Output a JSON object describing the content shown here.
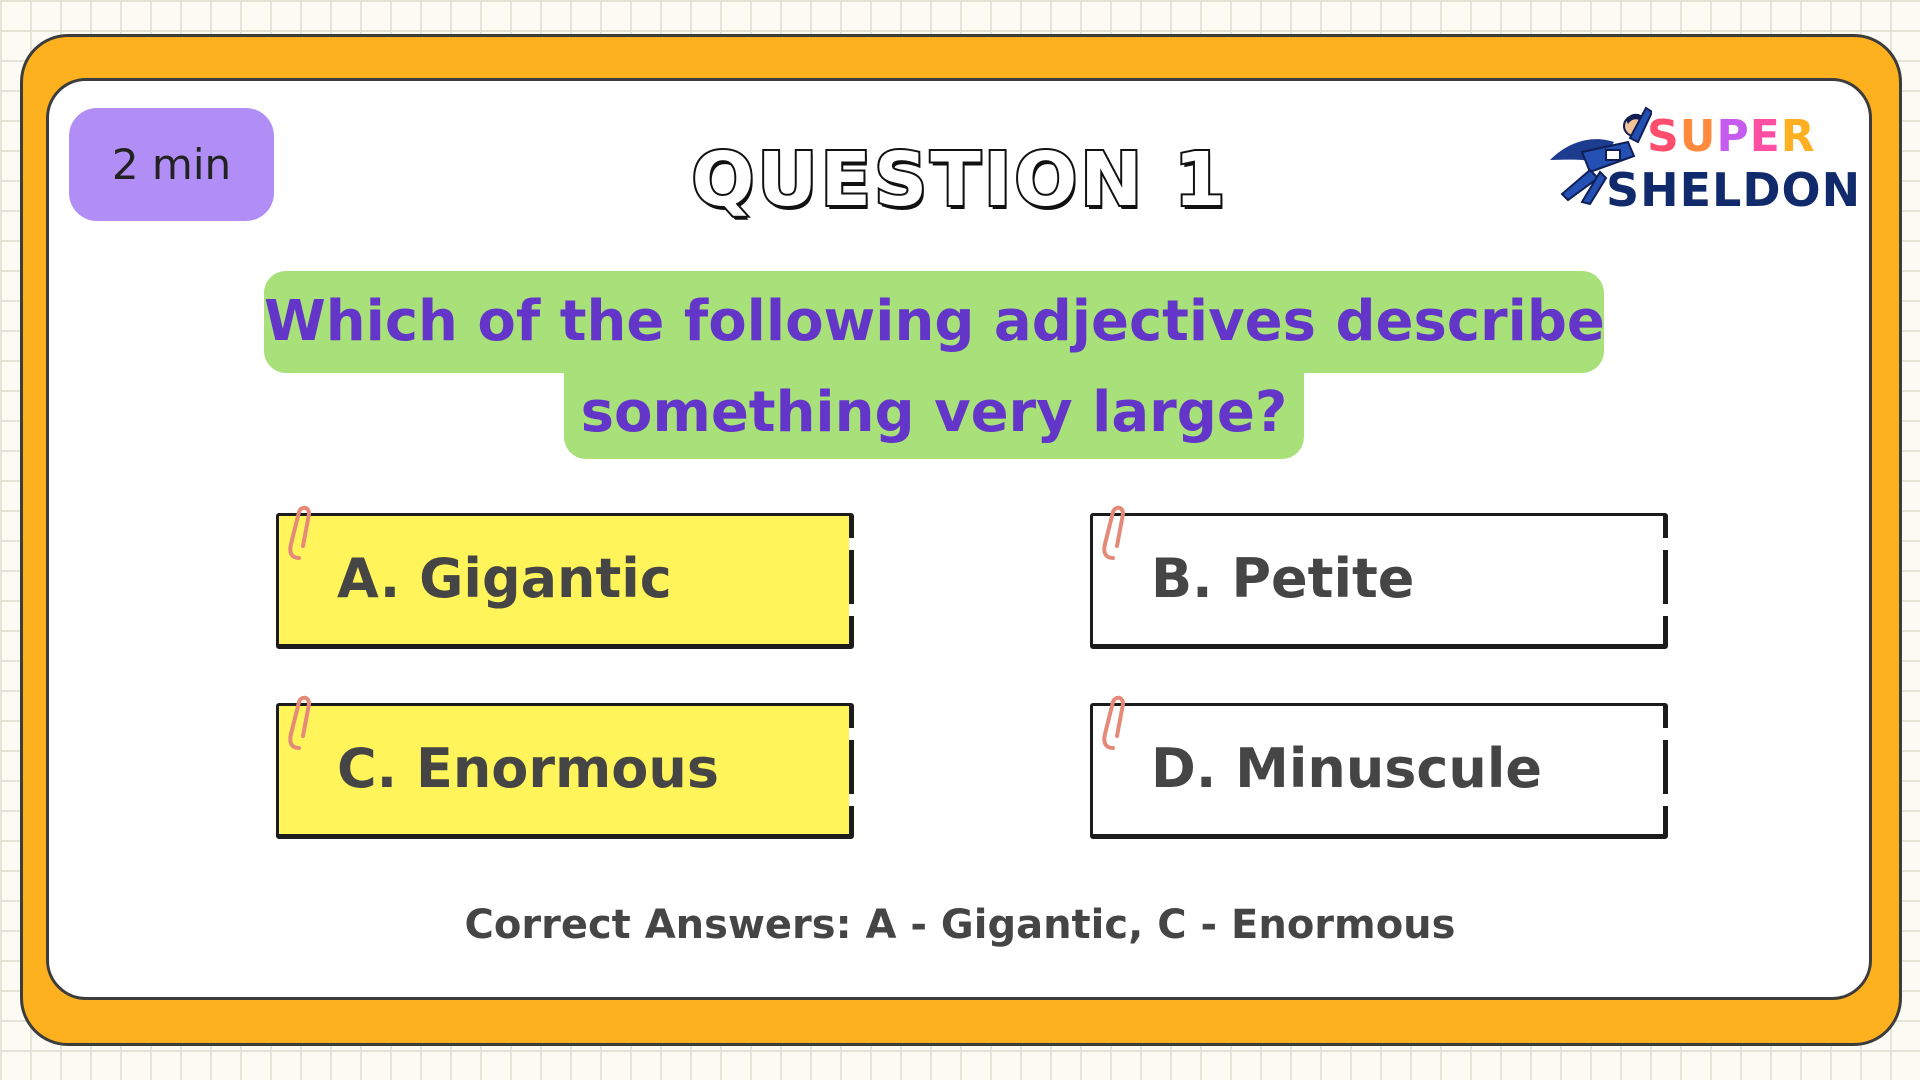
{
  "timer": {
    "label": "2 min"
  },
  "heading": {
    "title": "QUESTION 1"
  },
  "logo": {
    "word1": "SUPER",
    "word2": "SHELDON",
    "word1_colors": [
      "#ff4d6d",
      "#ff8a3d",
      "#c65bf0",
      "#ff4fa3",
      "#ffb020"
    ]
  },
  "question": {
    "line1": "Which of the following adjectives describe",
    "line2": "something very large?"
  },
  "options": [
    {
      "label": "A. Gigantic",
      "highlighted": true
    },
    {
      "label": "B. Petite",
      "highlighted": false
    },
    {
      "label": "C. Enormous",
      "highlighted": true
    },
    {
      "label": "D. Minuscule",
      "highlighted": false
    }
  ],
  "answers": {
    "text": "Correct Answers: A - Gigantic, C - Enormous"
  },
  "colors": {
    "frame": "#feb11e",
    "timer_bg": "#b18ef5",
    "question_bg": "#a8e07a",
    "question_text": "#6335c9",
    "highlight": "#fff45a",
    "clip": "#e58a78"
  }
}
